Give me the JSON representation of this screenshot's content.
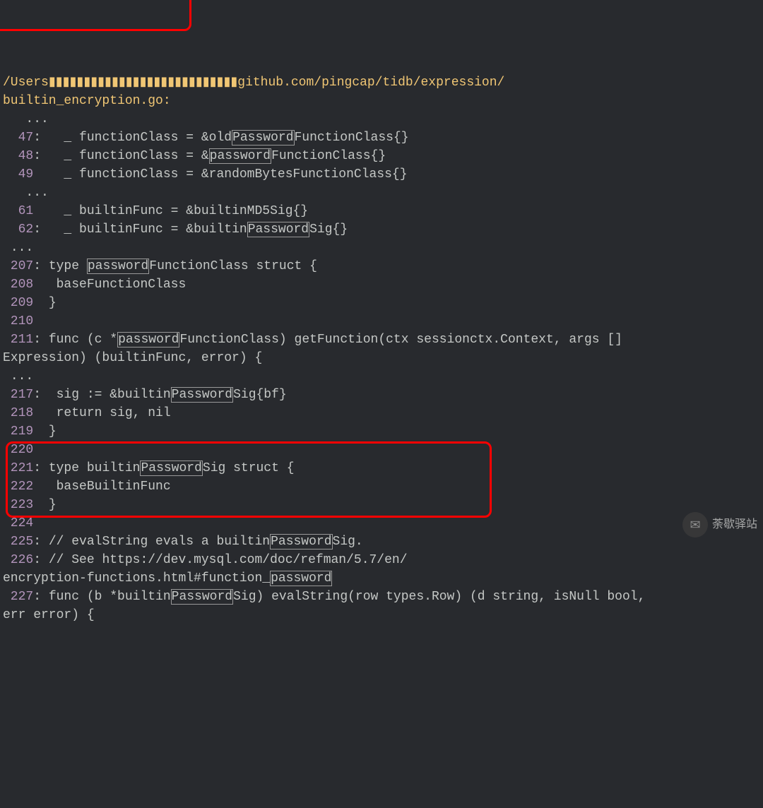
{
  "path_prefix": "/Users",
  "obscured": "▮▮▮▮▮▮▮▮▮▮▮▮▮▮▮▮▮▮▮▮▮▮▮▮▮▮▮",
  "path_suffix": "github.com/pingcap/tidb/expression/",
  "filename": "builtin_encryption.go",
  "watermark_text": "荼歇驿站",
  "lines": [
    {
      "ellipsis": true,
      "indent": "   ",
      "text": "..."
    },
    {
      "num": "47",
      "match": true,
      "indent": "   ",
      "parts": [
        {
          "t": "_ functionClass = &old"
        },
        {
          "t": "Password",
          "hl": true
        },
        {
          "t": "FunctionClass{}"
        }
      ]
    },
    {
      "num": "48",
      "match": true,
      "indent": "   ",
      "parts": [
        {
          "t": "_ functionClass = &"
        },
        {
          "t": "password",
          "hl": true
        },
        {
          "t": "FunctionClass{}"
        }
      ]
    },
    {
      "num": "49",
      "match": false,
      "indent": "   ",
      "parts": [
        {
          "t": "_ functionClass = &randomBytesFunctionClass{}"
        }
      ]
    },
    {
      "ellipsis": true,
      "indent": "   ",
      "text": "..."
    },
    {
      "num": "61",
      "match": false,
      "indent": "   ",
      "parts": [
        {
          "t": "_ builtinFunc = &builtinMD5Sig{}"
        }
      ]
    },
    {
      "num": "62",
      "match": true,
      "indent": "   ",
      "parts": [
        {
          "t": "_ builtinFunc = &builtin"
        },
        {
          "t": "Password",
          "hl": true
        },
        {
          "t": "Sig{}"
        }
      ]
    },
    {
      "ellipsis": true,
      "indent": " ",
      "text": "..."
    },
    {
      "num": "207",
      "match": true,
      "indent": " ",
      "parts": [
        {
          "t": "type "
        },
        {
          "t": "password",
          "hl": true
        },
        {
          "t": "FunctionClass struct {"
        }
      ]
    },
    {
      "num": "208",
      "match": false,
      "indent": "  ",
      "parts": [
        {
          "t": "baseFunctionClass"
        }
      ]
    },
    {
      "num": "209",
      "match": false,
      "indent": " ",
      "parts": [
        {
          "t": "}"
        }
      ]
    },
    {
      "num": "210",
      "match": false,
      "indent": "",
      "parts": []
    },
    {
      "num": "211",
      "match": true,
      "indent": " ",
      "parts": [
        {
          "t": "func (c *"
        },
        {
          "t": "password",
          "hl": true
        },
        {
          "t": "FunctionClass) getFunction(ctx sessionctx.Context, args []"
        }
      ]
    },
    {
      "cont": true,
      "indent": "",
      "parts": [
        {
          "t": "Expression) (builtinFunc, error) {"
        }
      ]
    },
    {
      "ellipsis": true,
      "indent": " ",
      "text": "..."
    },
    {
      "num": "217",
      "match": true,
      "indent": "  ",
      "parts": [
        {
          "t": "sig := &builtin"
        },
        {
          "t": "Password",
          "hl": true
        },
        {
          "t": "Sig{bf}"
        }
      ]
    },
    {
      "num": "218",
      "match": false,
      "indent": "  ",
      "parts": [
        {
          "t": "return sig, nil"
        }
      ]
    },
    {
      "num": "219",
      "match": false,
      "indent": " ",
      "parts": [
        {
          "t": "}"
        }
      ]
    },
    {
      "num": "220",
      "match": false,
      "indent": "",
      "parts": []
    },
    {
      "num": "221",
      "match": true,
      "indent": " ",
      "parts": [
        {
          "t": "type builtin"
        },
        {
          "t": "Password",
          "hl": true
        },
        {
          "t": "Sig struct {"
        }
      ]
    },
    {
      "num": "222",
      "match": false,
      "indent": "  ",
      "parts": [
        {
          "t": "baseBuiltinFunc"
        }
      ]
    },
    {
      "num": "223",
      "match": false,
      "indent": " ",
      "parts": [
        {
          "t": "}"
        }
      ]
    },
    {
      "num": "224",
      "match": false,
      "indent": " ",
      "parts": []
    },
    {
      "num": "225",
      "match": true,
      "indent": " ",
      "parts": [
        {
          "t": "// evalString evals a builtin"
        },
        {
          "t": "Password",
          "hl": true
        },
        {
          "t": "Sig."
        }
      ]
    },
    {
      "num": "226",
      "match": true,
      "indent": " ",
      "parts": [
        {
          "t": "// See https://dev.mysql.com/doc/refman/5.7/en/"
        }
      ]
    },
    {
      "cont": true,
      "indent": "",
      "parts": [
        {
          "t": "encryption-functions.html#function_"
        },
        {
          "t": "password",
          "hl": true
        }
      ]
    },
    {
      "num": "227",
      "match": true,
      "indent": " ",
      "parts": [
        {
          "t": "func (b *builtin"
        },
        {
          "t": "Password",
          "hl": true
        },
        {
          "t": "Sig) evalString(row types.Row) (d string, isNull bool,"
        }
      ]
    },
    {
      "cont": true,
      "indent": "",
      "parts": [
        {
          "t": "err error) {"
        }
      ]
    }
  ]
}
